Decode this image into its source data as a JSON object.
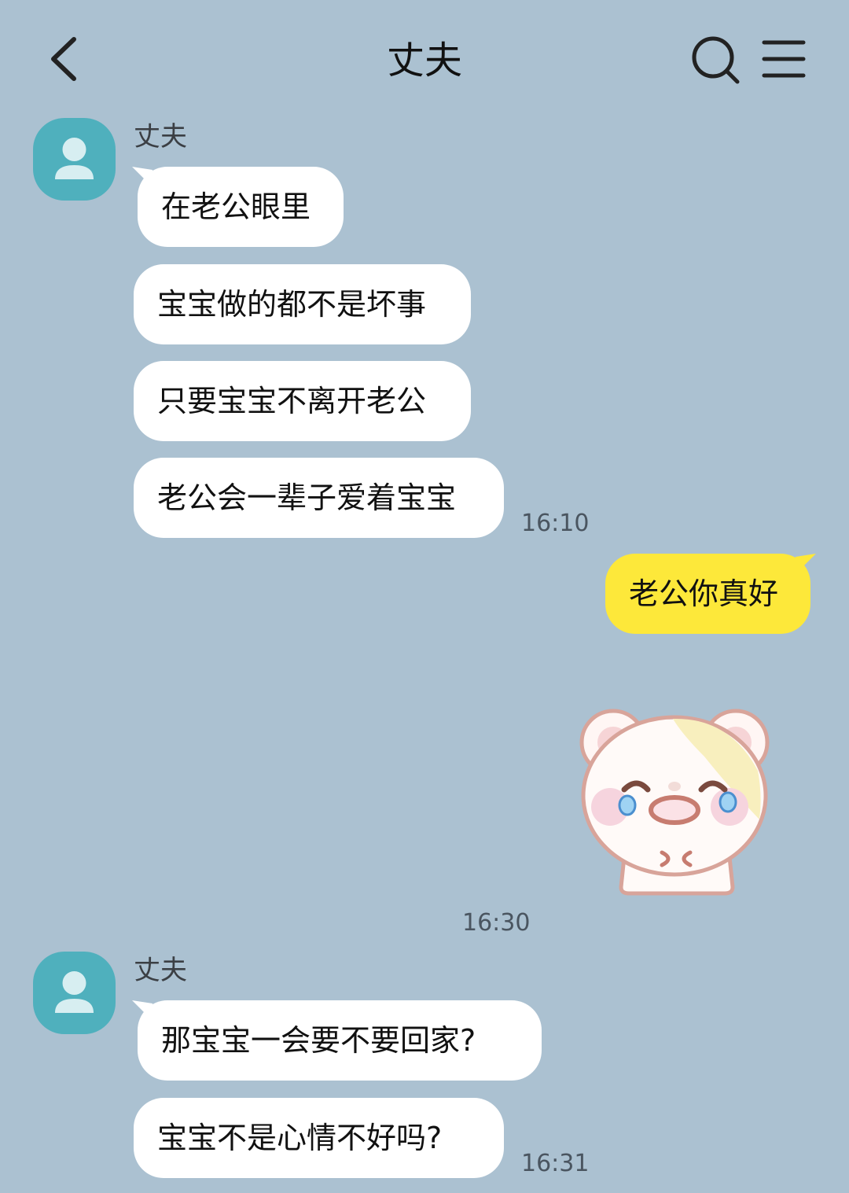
{
  "header": {
    "title": "丈夫",
    "back_icon": "chevron-left-icon",
    "search_icon": "search-icon",
    "menu_icon": "menu-icon"
  },
  "colors": {
    "background": "#abc1d1",
    "incoming_bubble": "#ffffff",
    "outgoing_bubble": "#fde83a",
    "avatar": "#4fb0bd"
  },
  "groups": [
    {
      "sender": "丈夫",
      "messages": [
        "在老公眼里",
        "宝宝做的都不是坏事",
        "只要宝宝不离开老公",
        "老公会一辈子爱着宝宝"
      ],
      "time": "16:10"
    },
    {
      "sender": "丈夫",
      "messages": [
        "那宝宝一会要不要回家?",
        "宝宝不是心情不好吗?"
      ],
      "time": "16:31"
    }
  ],
  "outgoing": {
    "text": "老公你真好",
    "sticker": "crying-bear-sticker",
    "sticker_time": "16:30"
  }
}
